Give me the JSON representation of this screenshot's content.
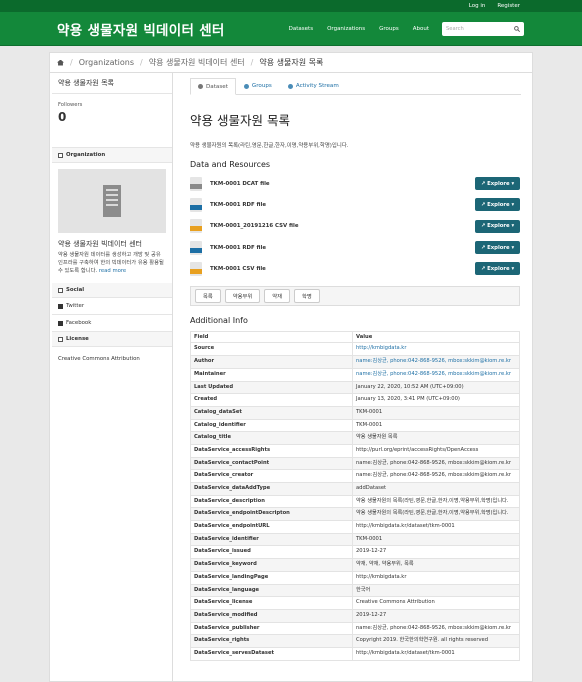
{
  "topbar": {
    "login": "Log in",
    "register": "Register"
  },
  "header": {
    "brand": "약용 생물자원 빅데이터 센터",
    "nav": [
      "Datasets",
      "Organizations",
      "Groups",
      "About"
    ],
    "search_placeholder": "Search"
  },
  "breadcrumb": {
    "items": [
      "Organizations",
      "약용 생물자원 빅데이터 센터",
      "약용 생물자원 목록"
    ]
  },
  "sidebar": {
    "title": "약용 생물자원 목록",
    "followers_label": "Followers",
    "followers_count": "0",
    "org_heading": "Organization",
    "org_name": "약용 생물자원 빅데이터 센터",
    "org_desc": "약용 생물자원 데이터를 생성하고 개방 및 공유 인프라를 구축하여 한의 빅데이터가 유용 활용될 수 있도록 합니다.",
    "read_more": "read more",
    "social_heading": "Social",
    "twitter": "Twitter",
    "facebook": "Facebook",
    "license_heading": "License",
    "license": "Creative Commons Attribution"
  },
  "tabs": [
    "Dataset",
    "Groups",
    "Activity Stream"
  ],
  "dataset": {
    "title": "약용 생물자원 목록",
    "notes": "약용 생물자원의 목록(라틴,영문,한글,한자,이명,약용부위,학명)입니다.",
    "resources_heading": "Data and Resources",
    "resources": [
      {
        "name": "TKM-0001 DCAT file",
        "color": "#8a8a8a"
      },
      {
        "name": "TKM-0001 RDF file",
        "color": "#1d6fa5"
      },
      {
        "name": "TKM-0001_20191216 CSV file",
        "color": "#e8a020"
      },
      {
        "name": "TKM-0001 RDF file",
        "color": "#1d6fa5"
      },
      {
        "name": "TKM-0001 CSV file",
        "color": "#e8a020"
      }
    ],
    "explore_label": "Explore ▾",
    "tags": [
      "목록",
      "약용부위",
      "약재",
      "학명"
    ],
    "additional_heading": "Additional Info",
    "col_field": "Field",
    "col_value": "Value",
    "info": [
      [
        "Source",
        "http://kmbigdata.kr",
        true
      ],
      [
        "Author",
        "name:김상균, phone:042-868-9526, mbox:skkim@kiom.re.kr",
        true
      ],
      [
        "Maintainer",
        "name:김상균, phone:042-868-9526, mbox:skkim@kiom.re.kr",
        true
      ],
      [
        "Last Updated",
        "January 22, 2020, 10:52 AM (UTC+09:00)",
        false
      ],
      [
        "Created",
        "January 13, 2020, 3:41 PM (UTC+09:00)",
        false
      ],
      [
        "Catalog_dataSet",
        "TKM-0001",
        false
      ],
      [
        "Catalog_identifier",
        "TKM-0001",
        false
      ],
      [
        "Catalog_title",
        "약용 생물자원 목록",
        false
      ],
      [
        "DataService_accessRights",
        "http://purl.org/eprint/accessRights/OpenAccess",
        false
      ],
      [
        "DataService_contactPoint",
        "name:김상균, phone:042-868-9526, mbox:skkim@kiom.re.kr",
        false
      ],
      [
        "DataService_creator",
        "name:김상균, phone:042-868-9526, mbox:skkim@kiom.re.kr",
        false
      ],
      [
        "DataService_dataAddType",
        "addDataset",
        false
      ],
      [
        "DataService_description",
        "약용 생물자원의 목록(라틴,영문,한글,한자,이명,약용부위,학명)입니다.",
        false
      ],
      [
        "DataService_endpointDescripton",
        "약용 생물자원의 목록(라틴,영문,한글,한자,이명,약용부위,학명)입니다.",
        false
      ],
      [
        "DataService_endpointURL",
        "http://kmbigdata.kr/dataset/tkm-0001",
        false
      ],
      [
        "DataService_identifier",
        "TKM-0001",
        false
      ],
      [
        "DataService_issued",
        "2019-12-27",
        false
      ],
      [
        "DataService_keyword",
        "약재, 약재, 약용부위, 목록",
        false
      ],
      [
        "DataService_landingPage",
        "http://kmbigdata.kr",
        false
      ],
      [
        "DataService_language",
        "한국어",
        false
      ],
      [
        "DataService_license",
        "Creative Commons Attribution",
        false
      ],
      [
        "DataService_modified",
        "2019-12-27",
        false
      ],
      [
        "DataService_publisher",
        "name:김상균, phone:042-868-9526, mbox:skkim@kiom.re.kr",
        false
      ],
      [
        "DataService_rights",
        "Copyright 2019. 한국한의학연구원. all rights reserved",
        false
      ],
      [
        "DataService_servesDataset",
        "http://kmbigdata.kr/dataset/tkm-0001",
        false
      ]
    ]
  }
}
